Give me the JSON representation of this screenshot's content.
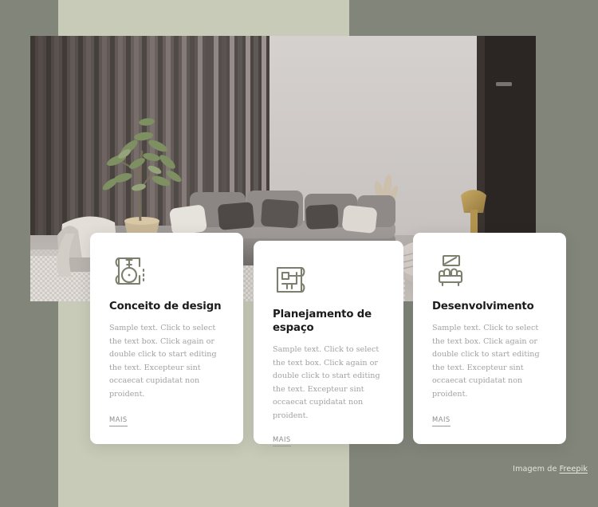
{
  "page": {
    "background_color": "#82867a",
    "accent_block_color": "#c9cbb9",
    "icon_color": "#7d7f6d"
  },
  "hero": {
    "name": "living-room-interior-photo",
    "alt": "Modern living room with grey sectional sofa, fluted wall panelling, olive tree plant, gold table lamp and knitted pouf"
  },
  "cards": [
    {
      "icon": "blueprint-compass-icon",
      "title": "Conceito de design",
      "body": "Sample text. Click to select the text box. Click again or double click to start editing the text. Excepteur sint occaecat cupidatat non proident.",
      "link_label": "MAIS"
    },
    {
      "icon": "floor-plan-icon",
      "title": "Planejamento de espaço",
      "body": "Sample text. Click to select the text box. Click again or double click to start editing the text. Excepteur sint occaecat cupidatat non proident.",
      "link_label": "MAIS"
    },
    {
      "icon": "sofa-picture-frame-icon",
      "title": "Desenvolvimento",
      "body": "Sample text. Click to select the text box. Click again or double click to start editing the text. Excepteur sint occaecat cupidatat non proident.",
      "link_label": "MAIS"
    }
  ],
  "attribution": {
    "prefix": "Imagem de ",
    "link_label": "Freepik"
  }
}
